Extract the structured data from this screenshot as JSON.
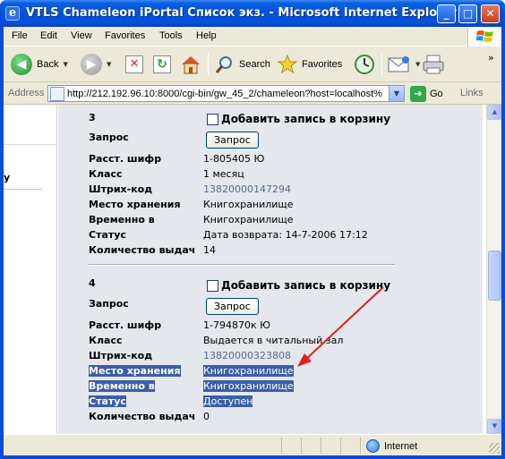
{
  "window": {
    "title": "VTLS Chameleon iPortal Список экз. - Microsoft Internet Explorer"
  },
  "menu": [
    "File",
    "Edit",
    "View",
    "Favorites",
    "Tools",
    "Help"
  ],
  "toolbar": {
    "back_label": "Back",
    "search_label": "Search",
    "favorites_label": "Favorites"
  },
  "address": {
    "label": "Address",
    "url": "http://212.192.96.10:8000/cgi-bin/gw_45_2/chameleon?host=localhost%",
    "go_label": "Go",
    "links_label": "Links"
  },
  "left_pane": {
    "fragment": "у"
  },
  "records": [
    {
      "number": "3",
      "basket_label": "Добавить запись в корзину",
      "request_label": "Запрос",
      "request_button": "Запрос",
      "fields": [
        {
          "label": "Расст. шифр",
          "value": "1-805405 Ю"
        },
        {
          "label": "Класс",
          "value": "1 месяц"
        },
        {
          "label": "Штрих-код",
          "value": "13820000147294"
        },
        {
          "label": "Место хранения",
          "value": "Книгохранилище"
        },
        {
          "label": "Временно в",
          "value": "Книгохранилище"
        },
        {
          "label": "Статус",
          "value": "Дата возврата: 14-7-2006 17:12"
        },
        {
          "label": "Количество выдач",
          "value": "14"
        }
      ]
    },
    {
      "number": "4",
      "basket_label": "Добавить запись в корзину",
      "request_label": "Запрос",
      "request_button": "Запрос",
      "fields": [
        {
          "label": "Расст. шифр",
          "value": "1-794870к Ю"
        },
        {
          "label": "Класс",
          "value": "Выдается в читальный зал"
        },
        {
          "label": "Штрих-код",
          "value": "13820000323808"
        },
        {
          "label": "Место хранения",
          "value": "Книгохранилище"
        },
        {
          "label": "Временно в",
          "value": "Книгохранилище"
        },
        {
          "label": "Статус",
          "value": "Доступен"
        },
        {
          "label": "Количество выдач",
          "value": "0"
        }
      ]
    }
  ],
  "status": {
    "zone": "Internet"
  },
  "colors": {
    "title_blue": "#0451d8",
    "highlight": "#3b5ea8",
    "arrow": "#e0201c",
    "content_bg": "#e4e7ec"
  }
}
